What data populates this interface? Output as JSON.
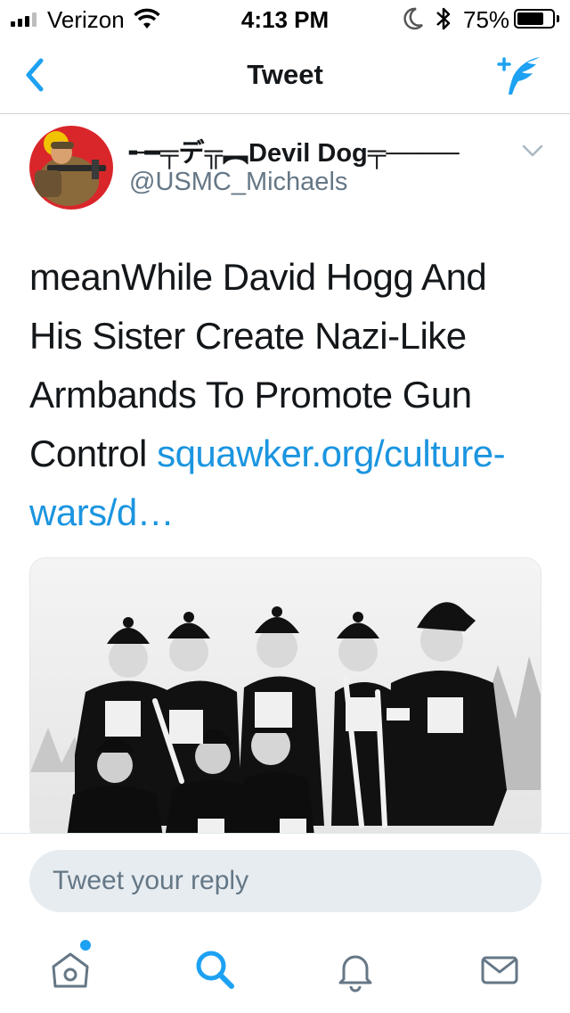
{
  "status_bar": {
    "carrier": "Verizon",
    "time": "4:13 PM",
    "battery_percent_text": "75%",
    "battery_level": 0.75,
    "icons": [
      "signal-icon",
      "wifi-icon",
      "moon-icon",
      "bluetooth-icon",
      "battery-icon"
    ]
  },
  "nav": {
    "title": "Tweet",
    "back_icon": "chevron-left-icon",
    "compose_icon": "compose-tweet-icon"
  },
  "tweet": {
    "author_name": "╾━╤デ╦︻Devil Dog╤────",
    "author_handle": "@USMC_Michaels",
    "text": "meanWhile David Hogg And His Sister Create Nazi-Like Armbands To Promote Gun Control",
    "link_text": "squawker.org/culture-wars/d…",
    "menu_icon": "chevron-down-icon"
  },
  "reply": {
    "placeholder": "Tweet your reply"
  },
  "tab_bar": {
    "items": [
      "home-icon",
      "search-icon",
      "notifications-icon",
      "messages-icon"
    ],
    "active": "search-icon"
  },
  "colors": {
    "accent": "#1da1f2",
    "link": "#1b95e0",
    "secondary_text": "#657786",
    "reply_field_bg": "#e6ecf0"
  }
}
